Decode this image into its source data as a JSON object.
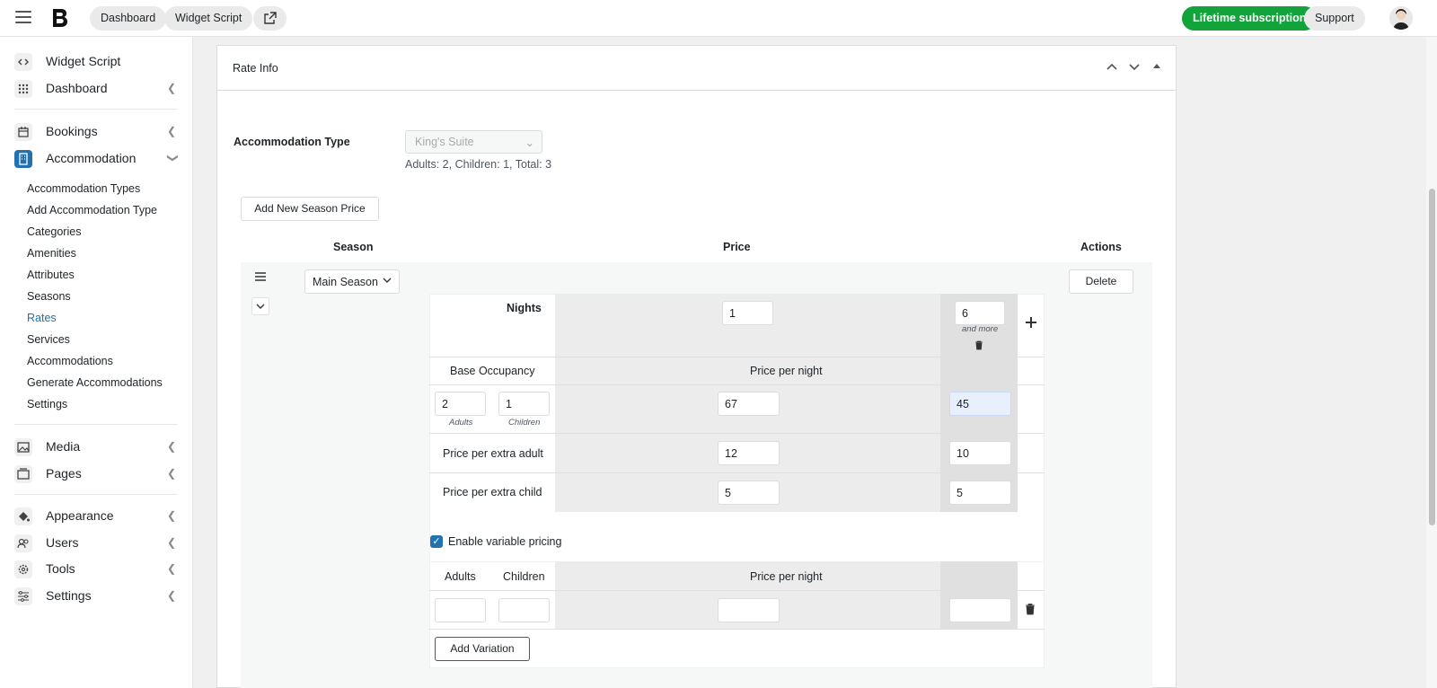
{
  "topbar": {
    "nav_pills": [
      "Dashboard",
      "Widget Script"
    ],
    "subscription_label": "Lifetime subscription",
    "support_label": "Support"
  },
  "sidebar": {
    "top_items": [
      {
        "label": "Widget Script",
        "icon": "code-icon"
      },
      {
        "label": "Dashboard",
        "icon": "grid-icon"
      }
    ],
    "bookings_label": "Bookings",
    "accommodation_label": "Accommodation",
    "accommodation_sub": [
      "Accommodation Types",
      "Add Accommodation Type",
      "Categories",
      "Amenities",
      "Attributes",
      "Seasons",
      "Rates",
      "Services",
      "Accommodations",
      "Generate Accommodations",
      "Settings"
    ],
    "media_label": "Media",
    "pages_label": "Pages",
    "appearance_label": "Appearance",
    "users_label": "Users",
    "tools_label": "Tools",
    "settings_label": "Settings",
    "active_color": "#2271b1"
  },
  "panel": {
    "title": "Rate Info",
    "accommodation_type_label": "Accommodation Type",
    "accommodation_type_value": "King's Suite",
    "occupancy_info": "Adults: 2, Children: 1, Total: 3",
    "add_season_button": "Add New Season Price",
    "columns": {
      "season": "Season",
      "price": "Price",
      "actions": "Actions"
    },
    "season_value": "Main Season",
    "delete_button": "Delete",
    "nights_label": "Nights",
    "nights_values": [
      "1",
      "6"
    ],
    "and_more": "and more",
    "base_occupancy_label": "Base Occupancy",
    "price_per_night_label": "Price per night",
    "base_adults": "2",
    "base_children": "1",
    "adults_caption": "Adults",
    "children_caption": "Children",
    "price_per_night_values": [
      "67",
      "45"
    ],
    "extra_adult_label": "Price per extra adult",
    "extra_adult_values": [
      "12",
      "10"
    ],
    "extra_child_label": "Price per extra child",
    "extra_child_values": [
      "5",
      "5"
    ],
    "variable_pricing_label": "Enable variable pricing",
    "variable_pricing_checked": true,
    "var_columns": {
      "adults": "Adults",
      "children": "Children",
      "price_per_night": "Price per night"
    },
    "add_variation_button": "Add Variation"
  }
}
